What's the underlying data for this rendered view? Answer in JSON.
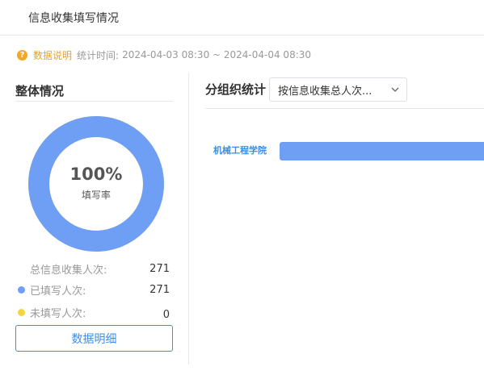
{
  "header": {
    "title": "信息收集填写情况"
  },
  "info": {
    "help_icon": "question-circle-icon",
    "data_desc_link": "数据说明",
    "stat_time_label": "统计时间:",
    "stat_time_range": "2024-04-03 08:30 ~ 2024-04-04 08:30"
  },
  "overall": {
    "title": "整体情况",
    "percent_text": "100%",
    "percent_label": "填写率",
    "fill_rate": 1.0,
    "colors": {
      "filled": "#6e9ff5",
      "unfilled": "#f5d442"
    },
    "stats": [
      {
        "label": "总信息收集人次:",
        "value": "271"
      },
      {
        "label": "已填写人次:",
        "value": "271"
      },
      {
        "label": "未填写人次:",
        "value": "0"
      }
    ],
    "detail_button": "数据明细"
  },
  "group": {
    "title": "分组织统计",
    "select_value": "按信息收集总人次...",
    "select_icon": "chevron-down-icon"
  },
  "chart_data": {
    "type": "bar",
    "orientation": "horizontal",
    "categories": [
      "机械工程学院"
    ],
    "values": [
      271
    ],
    "color": "#6e9ff5"
  }
}
